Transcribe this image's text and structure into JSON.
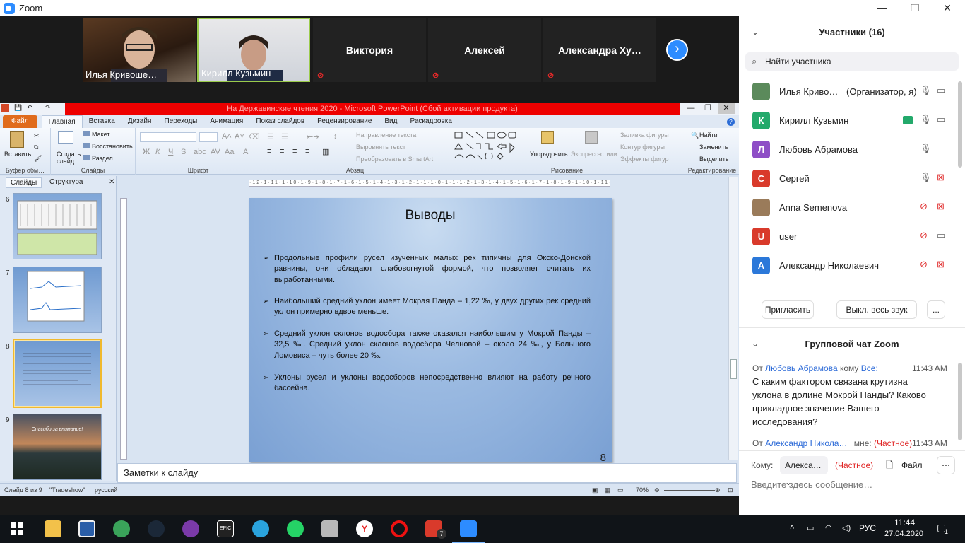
{
  "zoom": {
    "title": "Zoom",
    "window_controls": [
      "—",
      "❐",
      "✕"
    ],
    "videos": [
      {
        "name": "Илья Кривоше…"
      },
      {
        "name": "Кирилл Кузьмин"
      },
      {
        "name": "Виктория"
      },
      {
        "name": "Алексей"
      },
      {
        "name": "Александра  Ху…"
      }
    ],
    "next_icon": "chevron-right-icon"
  },
  "ppt": {
    "title": "На Державинские чтения 2020  -  Microsoft PowerPoint (Сбой активации продукта)",
    "tabs": [
      "Файл",
      "Главная",
      "Вставка",
      "Дизайн",
      "Переходы",
      "Анимация",
      "Показ слайдов",
      "Рецензирование",
      "Вид",
      "Раскадровка"
    ],
    "ribbon": {
      "paste": "Вставить",
      "clipboard_group": "Буфер обм…",
      "new_slide": "Создать слайд",
      "layout": "Макет",
      "reset": "Восстановить",
      "section": "Раздел",
      "slides_group": "Слайды",
      "font_group": "Шрифт",
      "text_direction": "Направление текста",
      "align_text": "Выровнять текст",
      "smartart": "Преобразовать в SmartArt",
      "paragraph_group": "Абзац",
      "arrange": "Упорядочить",
      "quick_styles": "Экспресс-стили",
      "shape_fill": "Заливка фигуры",
      "shape_outline": "Контур фигуры",
      "shape_effects": "Эффекты фигур",
      "drawing_group": "Рисование",
      "find": "Найти",
      "replace": "Заменить",
      "select": "Выделить",
      "editing_group": "Редактирование"
    },
    "left_tabs": [
      "Слайды",
      "Структура"
    ],
    "slide_numbers": [
      "6",
      "7",
      "8",
      "9"
    ],
    "thumb9_text": "Спасибо за внимание!",
    "ruler_text": "·12·1·11·1·10·1·9·1·8·1·7·1·6·1·5·1·4·1·3·1·2·1·1·1·0·1·1·1·2·1·3·1·4·1·5·1·6·1·7·1·8·1·9·1·10·1·11·1·12·",
    "slide": {
      "title": "Выводы",
      "bullets": [
        "Продольные профили русел изученных малых рек  типичны для Окско-Донской равнины, они обладают слабовогнутой формой, что позволяет считать их выработанными.",
        "Наибольший средний уклон имеет Мокрая Панда – 1,22 ‰, у двух других рек средний уклон примерно вдвое меньше.",
        "Средний уклон склонов водосбора также оказался наибольшим у Мокрой Панды – 32,5 ‰. Средний уклон склонов водосбора Челновой – около 24 ‰, у Большого Ломовиса – чуть более 20 ‰.",
        "Уклоны русел и уклоны водосборов непосредственно влияют на работу речного бассейна."
      ],
      "page_number": "8"
    },
    "notes_placeholder": "Заметки к слайду",
    "status": {
      "slide_of": "Слайд 8 из 9",
      "theme": "\"Tradeshow\"",
      "language": "русский",
      "zoom": "70%"
    }
  },
  "participants": {
    "header": "Участники (16)",
    "search_placeholder": "Найти участника",
    "list": [
      {
        "initial": "",
        "name": "Илья Криво…",
        "extra": "(Организатор, я)",
        "color": "#5b8a5b",
        "mic": "on",
        "cam": "on"
      },
      {
        "initial": "К",
        "name": "Кирилл Кузьмин",
        "extra": "",
        "color": "#23a96b",
        "mic": "on",
        "cam": "on"
      },
      {
        "initial": "Л",
        "name": "Любовь Абрамова",
        "extra": "",
        "color": "#8e4ec6",
        "mic": "on",
        "cam": ""
      },
      {
        "initial": "С",
        "name": "Сергей",
        "extra": "",
        "color": "#d93a2b",
        "mic": "on",
        "cam": "off"
      },
      {
        "initial": "",
        "name": "Anna Semenova",
        "extra": "",
        "color": "#9a7b5a",
        "mic": "off",
        "cam": "off"
      },
      {
        "initial": "U",
        "name": "user",
        "extra": "",
        "color": "#d93a2b",
        "mic": "off",
        "cam": "on"
      },
      {
        "initial": "А",
        "name": "Александр Николаевич",
        "extra": "",
        "color": "#2b78d9",
        "mic": "off",
        "cam": "off"
      }
    ],
    "invite": "Пригласить",
    "mute_all": "Выкл. весь звук",
    "more": "..."
  },
  "chat": {
    "header": "Групповой чат Zoom",
    "messages": [
      {
        "from_prefix": "От",
        "from": "Любовь Абрамова",
        "to_prefix": "кому",
        "to": "Все:",
        "time": "11:43 AM",
        "text": "С каким фактором связана крутизна уклона в долине  Мокрой Панды? Каково прикладное значение Вашего исследования?"
      },
      {
        "from_prefix": "От",
        "from": "Александр Никола…",
        "to_prefix": "мне:",
        "to": "(Частное)",
        "time": "11:43 AM",
        "text": ""
      }
    ],
    "to_label": "Кому:",
    "recipient": "Алекса…",
    "private": "(Частное)",
    "file": "Файл",
    "input_placeholder": "Введите здесь сообщение…"
  },
  "taskbar": {
    "time": "11:44",
    "date": "27.04.2020",
    "lang": "РУС",
    "notifications": "1",
    "badge": "7"
  }
}
